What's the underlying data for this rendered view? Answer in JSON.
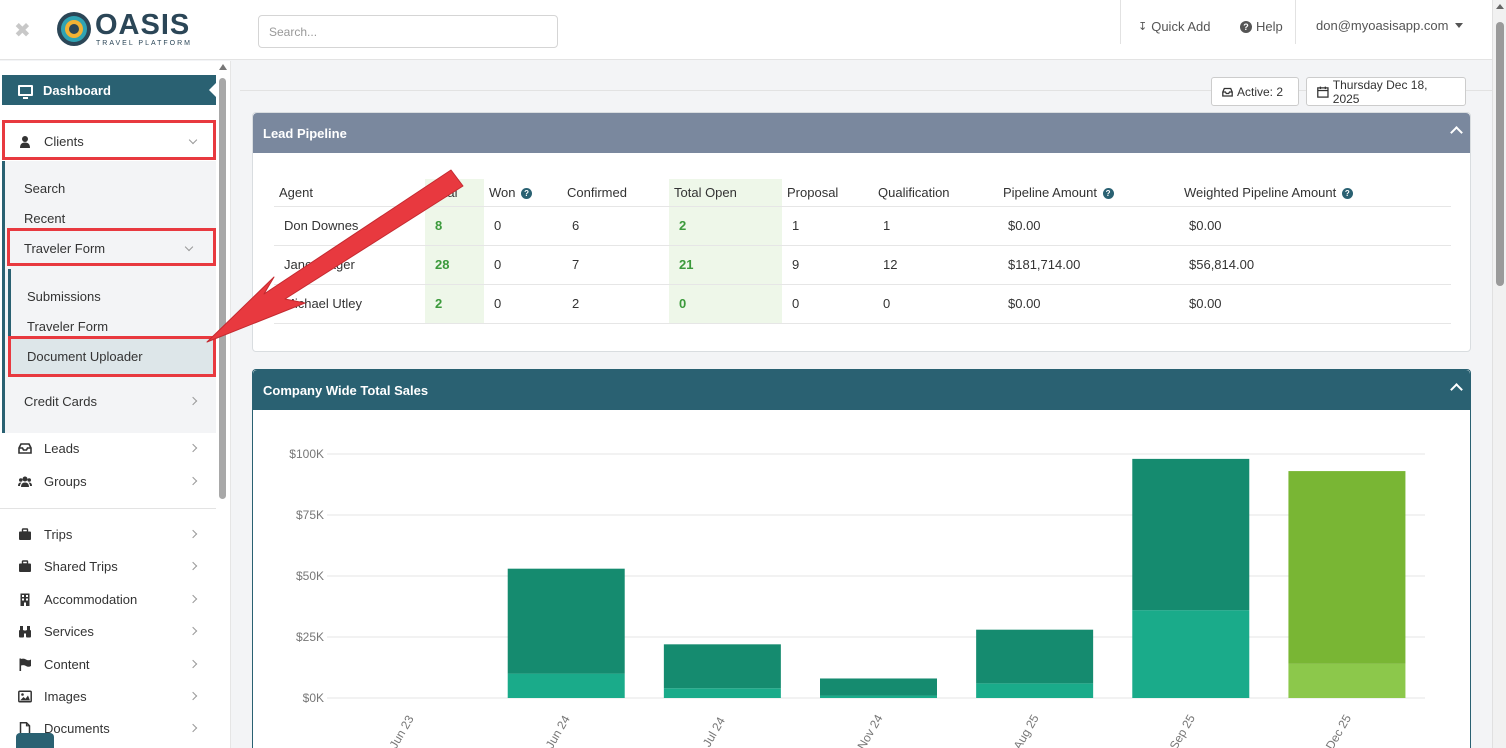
{
  "topbar": {
    "close_glyph": "✖",
    "logo_text": "OASIS",
    "logo_sub": "TRAVEL PLATFORM",
    "search_placeholder": "Search...",
    "quick_add": "Quick Add",
    "help": "Help",
    "user_email": "don@myoasisapp.com"
  },
  "sidebar": {
    "dashboard": "Dashboard",
    "clients": "Clients",
    "clients_sub": {
      "search": "Search",
      "recent": "Recent",
      "traveler_form": "Traveler Form",
      "traveler_sub": {
        "submissions": "Submissions",
        "traveler_form": "Traveler Form",
        "document_uploader": "Document Uploader"
      },
      "credit_cards": "Credit Cards"
    },
    "items": [
      {
        "label": "Leads",
        "icon": "inbox-icon"
      },
      {
        "label": "Groups",
        "icon": "users-icon"
      },
      {
        "label": "Trips",
        "icon": "briefcase-icon"
      },
      {
        "label": "Shared Trips",
        "icon": "briefcase-icon"
      },
      {
        "label": "Accommodation",
        "icon": "building-icon"
      },
      {
        "label": "Services",
        "icon": "binoculars-icon"
      },
      {
        "label": "Content",
        "icon": "flag-icon"
      },
      {
        "label": "Images",
        "icon": "image-icon"
      },
      {
        "label": "Documents",
        "icon": "document-icon"
      }
    ]
  },
  "status": {
    "active": "Active: 2",
    "date": "Thursday Dec 18, 2025"
  },
  "lead_pipeline": {
    "title": "Lead Pipeline",
    "columns": [
      "Agent",
      "Total",
      "Won",
      "Confirmed",
      "Total Open",
      "Proposal",
      "Qualification",
      "Pipeline Amount",
      "Weighted Pipeline Amount"
    ],
    "rows": [
      [
        "Don Downes",
        "8",
        "0",
        "6",
        "2",
        "1",
        "1",
        "$0.00",
        "$0.00"
      ],
      [
        "Janet Hager",
        "28",
        "0",
        "7",
        "21",
        "9",
        "12",
        "$181,714.00",
        "$56,814.00"
      ],
      [
        "Michael Utley",
        "2",
        "0",
        "2",
        "0",
        "0",
        "0",
        "$0.00",
        "$0.00"
      ]
    ]
  },
  "sales": {
    "title": "Company Wide Total Sales"
  },
  "colors": {
    "primary": "#2a6172",
    "pipeline_header": "#7a889e",
    "bar_dark": "#158b6f",
    "bar_light": "#1aab8a",
    "bar_green_dark": "#79b634",
    "bar_green_light": "#8cc84b",
    "highlight": "#e8393f"
  },
  "chart_data": {
    "type": "bar",
    "stacked": true,
    "categories": [
      "Jun 23",
      "Jun 24",
      "Jul 24",
      "Nov 24",
      "Aug 25",
      "Sep 25",
      "Dec 25"
    ],
    "series": [
      {
        "values": [
          0,
          10000,
          4000,
          1000,
          6000,
          36000,
          14000
        ]
      },
      {
        "values": [
          0,
          43000,
          18000,
          7000,
          22000,
          62000,
          79000
        ]
      }
    ],
    "ylim": [
      0,
      100000
    ],
    "yticks": [
      "$0K",
      "$25K",
      "$50K",
      "$75K",
      "$100K"
    ],
    "grid": true
  }
}
